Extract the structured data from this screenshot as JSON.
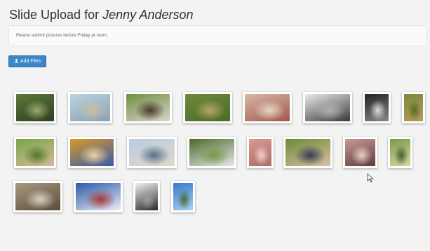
{
  "header": {
    "title_prefix": "Slide Upload for",
    "title_name": "Jenny Anderson"
  },
  "notice": {
    "text": "Please submit pictures before Friday at noon."
  },
  "toolbar": {
    "add_files_label": "Add Files",
    "add_files_icon": "upload-icon"
  },
  "photos": [
    {
      "id": "photo-1",
      "subject": "forest",
      "colors": [
        "#5d7a3a",
        "#2e3d22",
        "#9aa86a"
      ]
    },
    {
      "id": "photo-2",
      "subject": "beach-child",
      "colors": [
        "#bcd4e0",
        "#8aa2ae",
        "#cdbda2"
      ]
    },
    {
      "id": "photo-3",
      "subject": "couple-grass",
      "colors": [
        "#6e9040",
        "#d8d4c8",
        "#4a3a2a"
      ]
    },
    {
      "id": "photo-4",
      "subject": "park-walk",
      "colors": [
        "#6f8a3a",
        "#4a6a28",
        "#b8a56a"
      ]
    },
    {
      "id": "photo-5",
      "subject": "family-table",
      "colors": [
        "#d8b8a8",
        "#a0584a",
        "#e8d8c8"
      ]
    },
    {
      "id": "photo-6",
      "subject": "hug-bw",
      "colors": [
        "#eaeaea",
        "#3a3a3a",
        "#b0b0b0"
      ]
    },
    {
      "id": "photo-7",
      "subject": "portrait-bw",
      "colors": [
        "#222222",
        "#888888",
        "#dddddd"
      ]
    },
    {
      "id": "photo-8",
      "subject": "yard",
      "colors": [
        "#7a8a3a",
        "#b89a5a",
        "#5a6a2a"
      ]
    },
    {
      "id": "photo-9",
      "subject": "girl-bench",
      "colors": [
        "#7aa648",
        "#d6b89a",
        "#4c7a2a"
      ]
    },
    {
      "id": "photo-10",
      "subject": "kids-towel",
      "colors": [
        "#d89a2a",
        "#3a5aa8",
        "#e8d0a8"
      ]
    },
    {
      "id": "photo-11",
      "subject": "sea-walk",
      "colors": [
        "#b8cce0",
        "#e0d8cc",
        "#5a7088"
      ]
    },
    {
      "id": "photo-12",
      "subject": "wedding-lawn",
      "colors": [
        "#4a6a2a",
        "#e8e8e8",
        "#7a9a4a"
      ]
    },
    {
      "id": "photo-13",
      "subject": "mother-baby",
      "colors": [
        "#d89a90",
        "#b06a6a",
        "#f0d0c8"
      ]
    },
    {
      "id": "photo-14",
      "subject": "two-kids",
      "colors": [
        "#6a8a3a",
        "#d8c0a0",
        "#3a3a5a"
      ]
    },
    {
      "id": "photo-15",
      "subject": "mother-child",
      "colors": [
        "#c89a98",
        "#603a3a",
        "#e8d0c8"
      ]
    },
    {
      "id": "photo-16",
      "subject": "field-figure",
      "colors": [
        "#7a9a4a",
        "#d0d8a8",
        "#4a5a2a"
      ]
    },
    {
      "id": "photo-17",
      "subject": "bench-winter",
      "colors": [
        "#a89a80",
        "#5a4a3a",
        "#d8d0c0"
      ]
    },
    {
      "id": "photo-18",
      "subject": "snow-skiers",
      "colors": [
        "#2a5aa8",
        "#ececf4",
        "#a83a3a"
      ]
    },
    {
      "id": "photo-19",
      "subject": "woman-bw",
      "colors": [
        "#f0f0f0",
        "#2a2a2a",
        "#9a9a9a"
      ]
    },
    {
      "id": "photo-20",
      "subject": "sky-figure",
      "colors": [
        "#3a7ac8",
        "#a8d0f0",
        "#4a6a3a"
      ]
    }
  ]
}
